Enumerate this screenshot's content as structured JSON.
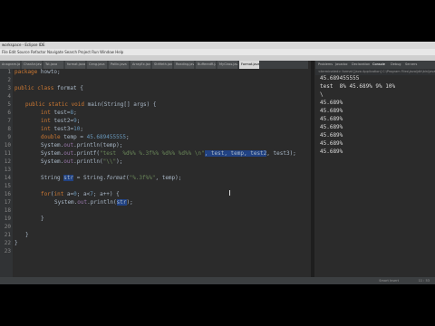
{
  "window": {
    "title": "workspace - Eclipse IDE",
    "menu": "File  Edit  Source  Refactor  Navigate  Search  Project  Run  Window  Help"
  },
  "editor": {
    "tabs": [
      "Anagram.java",
      "CharArr.java",
      "Tst.java",
      "format.java",
      "Ceng.java",
      "Pallin.java",
      "ArrayEx.java",
      "StrMeth.java",
      "Reading.java",
      "BufferedR.java",
      "MyClass.java",
      "Format.java"
    ],
    "active_tab_index": 11,
    "line_numbers": [
      "1",
      "2",
      "3",
      "4",
      "5",
      "6",
      "7",
      "8",
      "9",
      "10",
      "11",
      "12",
      "13",
      "14",
      "15",
      "16",
      "17",
      "18",
      "19",
      "20",
      "21",
      "22",
      "23"
    ],
    "code": {
      "l1_kw": "package",
      "l1_rest": " howto;",
      "l3_kw": "public class",
      "l3_rest": " format {",
      "l5_kw": "public static void",
      "l5_rest": " main(String[] args) {",
      "l6_kw": "int",
      "l6_rest": " test=",
      "l6_num": "8",
      "l7_kw": "int",
      "l7_rest": " test2=",
      "l7_num": "9",
      "l8_kw": "int",
      "l8_rest": " test3=",
      "l8_num": "10",
      "l9_kw": "double",
      "l9_rest": " temp = ",
      "l9_num": "45.689455555",
      "l10_sys": "System.",
      "l10_out": "out",
      "l10_rest": ".println(temp);",
      "l11_sys": "System.",
      "l11_out": "out",
      "l11_pf": ".printf(",
      "l11_str": "\"test  %d%% %.3f%% %d%% %d%% \\n\"",
      "l11_hl": ", test, temp, test2",
      "l11_end": ", test3);",
      "l12_sys": "System.",
      "l12_out": "out",
      "l12_pf": ".println(",
      "l12_str": "\"\\\\\"",
      "l12_end": ");",
      "l14_type": "String ",
      "l14_var": "str",
      "l14_mid": " = String.",
      "l14_fmt": "format",
      "l14_paren": "(",
      "l14_str": "\"%.3f%%\"",
      "l14_end": ", temp);",
      "l16_kw": "for",
      "l16_a": "(",
      "l16_int": "int",
      "l16_b": " a=",
      "l16_n0": "0",
      "l16_c": "; a<",
      "l16_n7": "7",
      "l16_d": "; a++) {",
      "l17_sys": "System.",
      "l17_out": "out",
      "l17_pl": ".println(",
      "l17_var": "str",
      "l17_end": ");",
      "l19_brace": "}",
      "l21_brace": "}",
      "l22_brace": "}"
    }
  },
  "console": {
    "tabs": [
      "Problems",
      "Javadoc",
      "Declaration",
      "Console",
      "Debug",
      "Servers"
    ],
    "header": "<terminated> format [Java Application] C:\\Program Files\\Java\\jdk\\bin\\javaw.exe",
    "lines": [
      "45.689455555",
      "test  8% 45.689% 9% 10%",
      "\\",
      "45.689%",
      "45.689%",
      "45.689%",
      "45.689%",
      "45.689%",
      "45.689%",
      "45.689%"
    ]
  },
  "status": {
    "position": "11 : 53",
    "mode": "Smart Insert"
  }
}
